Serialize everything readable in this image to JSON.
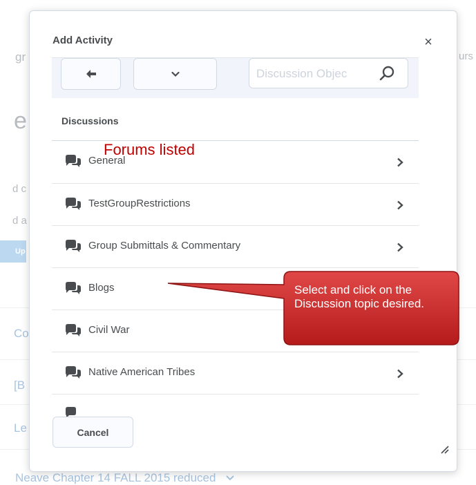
{
  "background_page": {
    "fragments_left": [
      "gr",
      "e",
      "d c",
      "d a",
      "Up",
      "Co",
      "[B",
      "Le"
    ],
    "fragment_right": "urs",
    "bottom_text": "Neave Chapter 14 FALL 2015 reduced"
  },
  "dialog": {
    "title": "Add Activity",
    "close_glyph": "×",
    "search_placeholder": "Discussion Objec",
    "section_label": "Discussions",
    "annotation": "Forums listed",
    "items": [
      {
        "label": "General",
        "has_chevron": true
      },
      {
        "label": "TestGroupRestrictions",
        "has_chevron": true
      },
      {
        "label": "Group Submittals & Commentary",
        "has_chevron": true
      },
      {
        "label": "Blogs",
        "has_chevron": false
      },
      {
        "label": "Civil War",
        "has_chevron": false
      },
      {
        "label": "Native American Tribes",
        "has_chevron": true
      }
    ],
    "cancel_label": "Cancel"
  },
  "callout": {
    "text": "Select and click on the Discussion topic desired."
  },
  "colors": {
    "callout_fill": "#cc1f1f",
    "annotation_red": "#c00000",
    "toolbar_bg": "#f1f5fb"
  },
  "icons": {
    "back": "arrow-left-icon",
    "menu": "chevron-down-icon",
    "search": "search-icon",
    "discussion": "speech-bubbles-icon",
    "row_arrow": "chevron-right-icon",
    "resize": "resize-handle-icon"
  }
}
